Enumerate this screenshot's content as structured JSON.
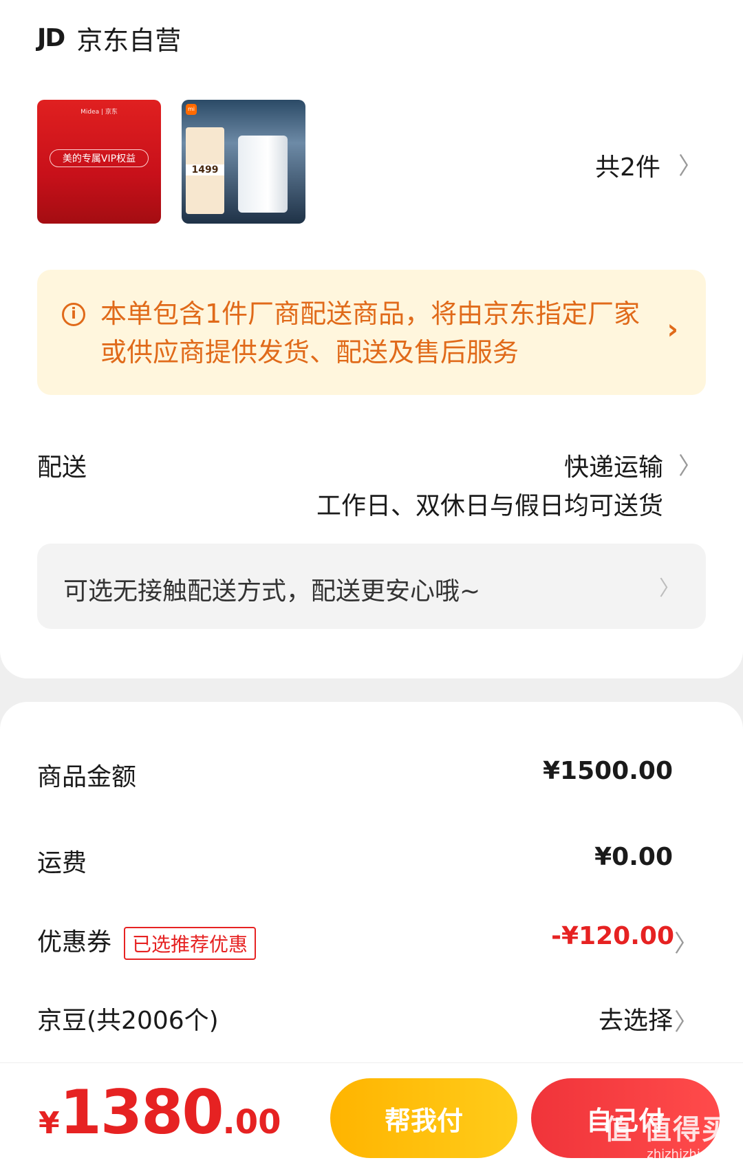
{
  "shop": {
    "logo_text": "JD",
    "name": "京东自营"
  },
  "items": {
    "thumb1": {
      "brand": "Midea | 京东",
      "badge": "美的专属VIP权益"
    },
    "thumb2": {
      "brand_badge": "mi",
      "promo_price": "1499"
    },
    "count_text": "共2件"
  },
  "notice": {
    "text": "本单包含1件厂商配送商品，将由京东指定厂家或供应商提供发货、配送及售后服务",
    "accent": "#e06a1a",
    "background": "#fff6dd"
  },
  "delivery": {
    "label": "配送",
    "type": "快递运输",
    "note": "工作日、双休日与假日均可送货",
    "contactless": "可选无接触配送方式，配送更安心哦~"
  },
  "amounts": {
    "goods": {
      "label": "商品金额",
      "value": "¥1500.00"
    },
    "shipping": {
      "label": "运费",
      "value": "¥0.00"
    },
    "coupon": {
      "label": "优惠券",
      "tag": "已选推荐优惠",
      "value": "-¥120.00"
    },
    "beans": {
      "label": "京豆(共2006个)",
      "value": "去选择"
    }
  },
  "footer": {
    "currency": "¥",
    "total_int": "1380",
    "total_dec": ".00",
    "help_pay": "帮我付",
    "self_pay": "自己付",
    "watermark": "值 值得买",
    "watermark_url": "zhizhizhi.com"
  },
  "colors": {
    "brand_red": "#e62222",
    "help_yellow": "#ffbf0f"
  }
}
